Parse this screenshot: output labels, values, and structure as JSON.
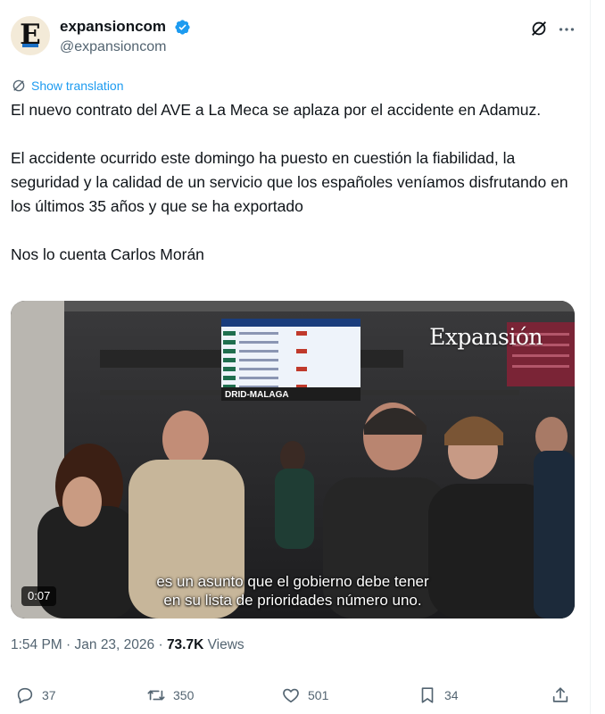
{
  "author": {
    "avatar_letter": "E",
    "display_name": "expansioncom",
    "handle": "@expansioncom",
    "verified": true
  },
  "translate_label": "Show translation",
  "tweet": {
    "paragraphs": [
      "El nuevo contrato del AVE a La Meca se aplaza por el accidente en Adamuz.",
      "El accidente ocurrido este domingo  ha puesto en cuestión la fiabilidad, la seguridad y la calidad de un servicio que los españoles veníamos disfrutando en los últimos 35 años y que se ha exportado",
      "Nos lo cuenta Carlos Morán"
    ]
  },
  "video": {
    "watermark": "Expansión",
    "board_caption": "DRID-MALAGA",
    "subtitle_line1": "es un asunto que el gobierno debe tener",
    "subtitle_line2": "en su lista de prioridades número uno.",
    "duration": "0:07"
  },
  "meta": {
    "time": "1:54 PM",
    "separator": " · ",
    "date": "Jan 23, 2026",
    "views_count": "73.7K",
    "views_label": " Views"
  },
  "actions": {
    "reply_count": "37",
    "retweet_count": "350",
    "like_count": "501",
    "bookmark_count": "34"
  },
  "colors": {
    "accent": "#1d9bf0",
    "text": "#0f1419",
    "secondary": "#536471"
  },
  "icons": [
    "verified-badge-icon",
    "grok-icon",
    "more-icon",
    "translate-icon",
    "reply-icon",
    "retweet-icon",
    "like-icon",
    "bookmark-icon",
    "share-icon"
  ]
}
